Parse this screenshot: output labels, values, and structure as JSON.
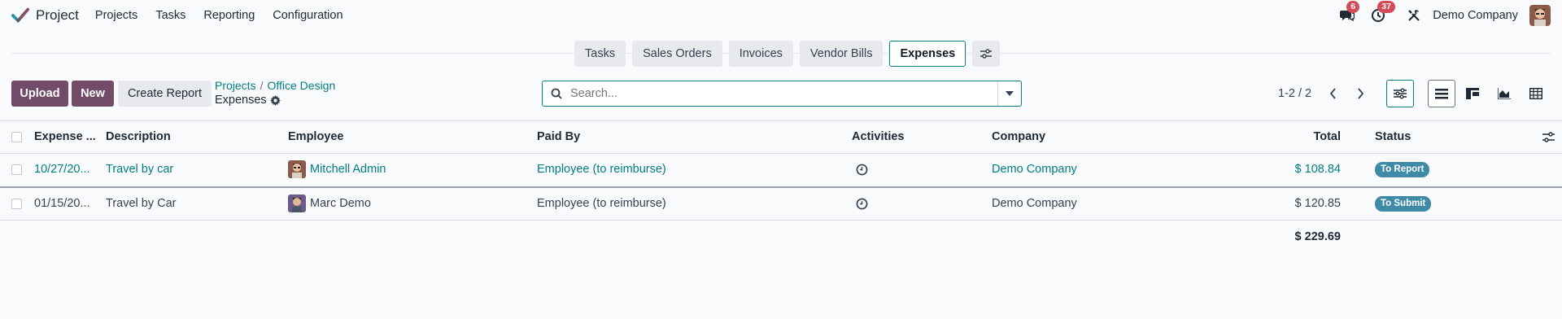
{
  "navbar": {
    "app_name": "Project",
    "menu": [
      "Projects",
      "Tasks",
      "Reporting",
      "Configuration"
    ],
    "messages_count": "6",
    "activities_count": "37",
    "company": "Demo Company"
  },
  "smart_buttons": [
    "Tasks",
    "Sales Orders",
    "Invoices",
    "Vendor Bills",
    "Expenses"
  ],
  "control": {
    "upload_label": "Upload",
    "new_label": "New",
    "create_report_label": "Create Report",
    "breadcrumb": [
      "Projects",
      "Office Design"
    ],
    "current": "Expenses",
    "search_placeholder": "Search...",
    "pager": "1-2 / 2"
  },
  "table": {
    "columns": [
      "Expense ...",
      "Description",
      "Employee",
      "Paid By",
      "Activities",
      "Company",
      "Total",
      "Status"
    ],
    "rows": [
      {
        "date": "10/27/20...",
        "description": "Travel by car",
        "employee": "Mitchell Admin",
        "paid_by": "Employee (to reimburse)",
        "company": "Demo Company",
        "total": "$ 108.84",
        "status": "To Report"
      },
      {
        "date": "01/15/20...",
        "description": "Travel by Car",
        "employee": "Marc Demo",
        "paid_by": "Employee (to reimburse)",
        "company": "Demo Company",
        "total": "$ 120.85",
        "status": "To Submit"
      }
    ],
    "grand_total": "$ 229.69"
  },
  "colors": {
    "accent": "#017e84",
    "primary": "#714b67",
    "badge": "#d44c59",
    "status": "#3f8aa6"
  },
  "icons": [
    "project-logo-icon",
    "chat-icon",
    "clock-icon",
    "tools-icon",
    "gear-icon",
    "search-icon",
    "caret-down-icon",
    "chevron-left-icon",
    "chevron-right-icon",
    "filter-settings-icon",
    "list-view-icon",
    "kanban-view-icon",
    "graph-view-icon",
    "pivot-view-icon",
    "column-settings-icon"
  ]
}
